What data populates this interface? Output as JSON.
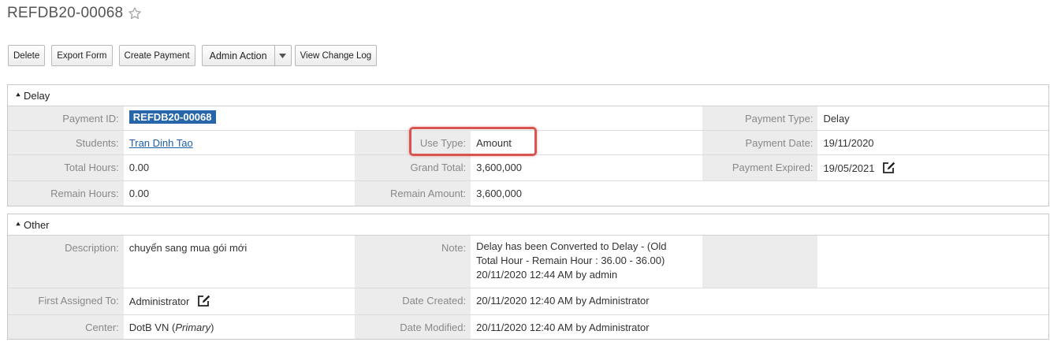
{
  "record": {
    "title": "REFDB20-00068"
  },
  "toolbar": {
    "delete": "Delete",
    "export": "Export Form",
    "create_payment": "Create Payment",
    "admin_action": "Admin Action",
    "view_change_log": "View Change Log"
  },
  "delay": {
    "heading": "Delay",
    "payment_id_label": "Payment ID:",
    "payment_id": "REFDB20-00068",
    "payment_type_label": "Payment Type:",
    "payment_type": "Delay",
    "students_label": "Students:",
    "students": "Tran Dinh Tao",
    "use_type_label": "Use Type:",
    "use_type": "Amount",
    "payment_date_label": "Payment Date:",
    "payment_date": "19/11/2020",
    "total_hours_label": "Total Hours:",
    "total_hours": "0.00",
    "grand_total_label": "Grand Total:",
    "grand_total": "3,600,000",
    "payment_expired_label": "Payment Expired:",
    "payment_expired": "19/05/2021",
    "remain_hours_label": "Remain Hours:",
    "remain_hours": "0.00",
    "remain_amount_label": "Remain Amount:",
    "remain_amount": "3,600,000"
  },
  "other": {
    "heading": "Other",
    "description_label": "Description:",
    "description": "chuyển sang mua gói mới",
    "note_label": "Note:",
    "note_line1": "Delay has been Converted to Delay - (Old",
    "note_line2": "Total Hour - Remain Hour : 36.00 - 36.00)",
    "note_line3": "20/11/2020 12:44 AM by admin",
    "first_assigned_label": "First Assigned To:",
    "first_assigned": "Administrator",
    "date_created_label": "Date Created:",
    "date_created": "20/11/2020 12:40 AM by Administrator",
    "center_label": "Center:",
    "center": "DotB VN",
    "center_tag": "Primary",
    "date_modified_label": "Date Modified:",
    "date_modified": "20/11/2020 12:40 AM by Administrator"
  },
  "colors": {
    "badge": "#2766a8",
    "highlight": "#d9534f",
    "link": "#1f5fa8"
  }
}
